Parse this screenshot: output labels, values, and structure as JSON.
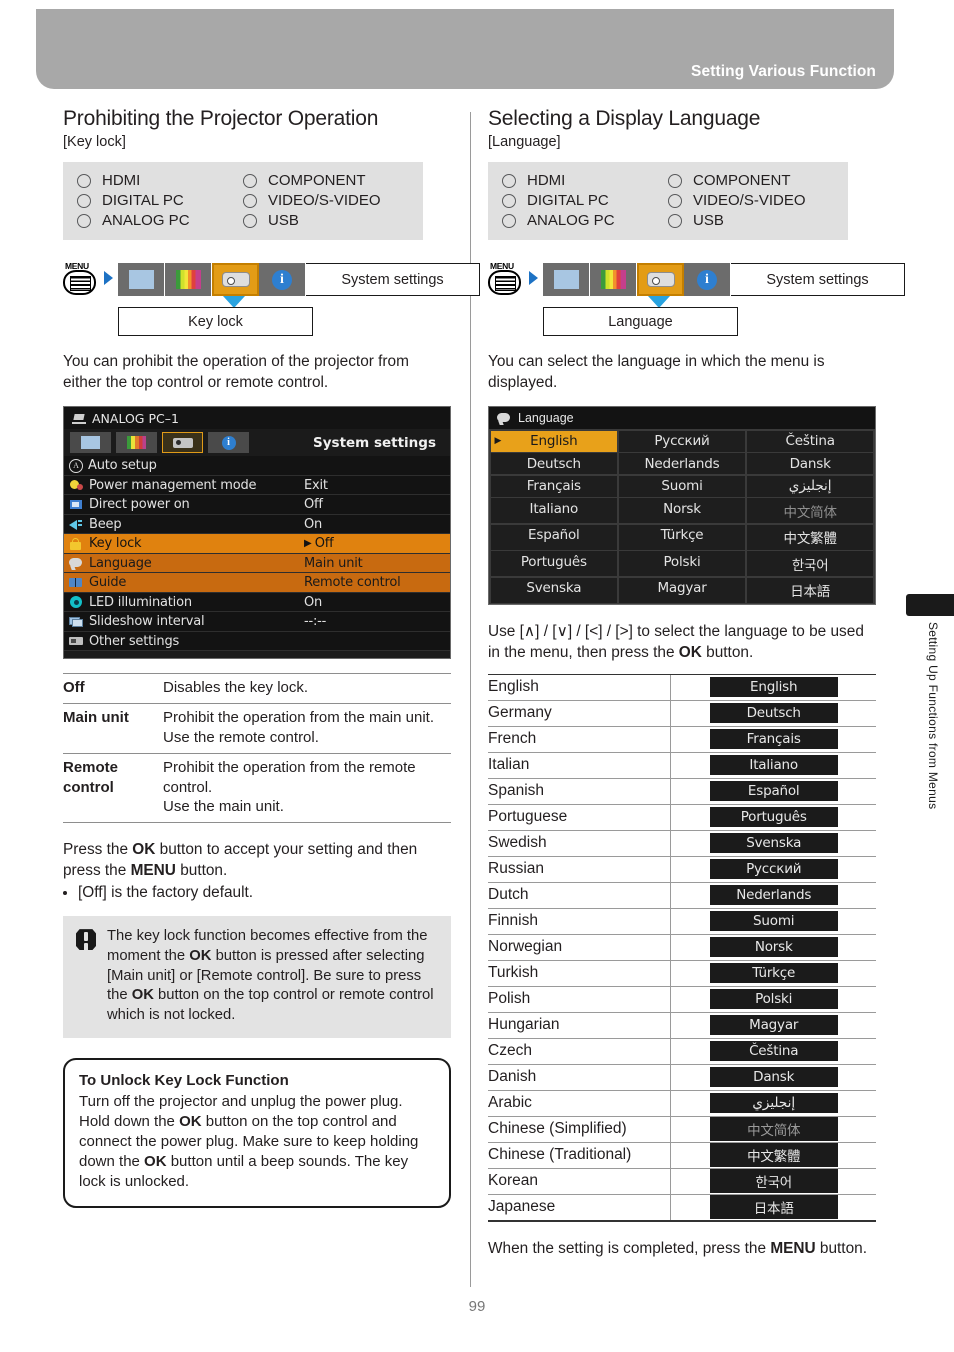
{
  "header": {
    "title": "Setting Various Function"
  },
  "page_number": "99",
  "side_tab": {
    "label": "Setting Up Functions from Menus"
  },
  "left": {
    "heading": "Prohibiting the Projector Operation",
    "bracket": "[Key lock]",
    "sources": [
      "HDMI",
      "COMPONENT",
      "DIGITAL PC",
      "VIDEO/S-VIDEO",
      "ANALOG PC",
      "USB"
    ],
    "nav": {
      "menu_label": "MENU",
      "system_settings": "System settings",
      "selected_label": "Key lock"
    },
    "intro": "You can prohibit the operation of the projector from either the top control or remote control.",
    "osd": {
      "title": "ANALOG PC–1",
      "system_settings": "System settings",
      "rows": [
        {
          "icon": "auto-setup-icon",
          "label": "Auto setup",
          "value": "",
          "state": "normal"
        },
        {
          "icon": "power-management-icon",
          "label": "Power management mode",
          "value": "Exit",
          "state": "normal"
        },
        {
          "icon": "direct-power-on-icon",
          "label": "Direct power on",
          "value": "Off",
          "state": "normal"
        },
        {
          "icon": "beep-icon",
          "label": "Beep",
          "value": "On",
          "state": "normal"
        },
        {
          "icon": "key-lock-icon",
          "label": "Key lock",
          "value": "Off",
          "state": "highlight"
        },
        {
          "icon": "language-icon",
          "label": "Language",
          "value": "Main unit",
          "state": "sub"
        },
        {
          "icon": "guide-icon",
          "label": "Guide",
          "value": "Remote control",
          "state": "sub"
        },
        {
          "icon": "led-illumination-icon",
          "label": "LED illumination",
          "value": "On",
          "state": "normal"
        },
        {
          "icon": "slideshow-interval-icon",
          "label": "Slideshow interval",
          "value": "--:--",
          "state": "normal"
        },
        {
          "icon": "other-settings-icon",
          "label": "Other settings",
          "value": "",
          "state": "normal"
        }
      ]
    },
    "table": [
      {
        "key": "Off",
        "desc": "Disables the key lock."
      },
      {
        "key": "Main unit",
        "desc": "Prohibit the operation from the main unit.\nUse the remote control."
      },
      {
        "key": "Remote control",
        "desc": "Prohibit the operation from the remote control.\nUse the main unit."
      }
    ],
    "press_ok": "Press the OK button to accept your setting and then press the MENU button.",
    "bullet": "[Off] is the factory default.",
    "note": "The key lock function becomes effective from the moment the OK button is pressed after selecting [Main unit] or [Remote control]. Be sure to press the OK button on the top control or remote control which is not locked.",
    "unlock_box": {
      "title": "To Unlock Key Lock Function",
      "body": "Turn off the projector and unplug the power plug. Hold down the OK button on the top control and connect the power plug. Make sure to keep holding down the OK button until a beep sounds. The key lock is unlocked."
    }
  },
  "right": {
    "heading": "Selecting a Display Language",
    "bracket": "[Language]",
    "sources": [
      "HDMI",
      "COMPONENT",
      "DIGITAL PC",
      "VIDEO/S-VIDEO",
      "ANALOG PC",
      "USB"
    ],
    "nav": {
      "menu_label": "MENU",
      "system_settings": "System settings",
      "selected_label": "Language"
    },
    "intro": "You can select the language in which the menu is displayed.",
    "osd": {
      "title": "Language",
      "grid": [
        {
          "label": "English",
          "state": "selected"
        },
        {
          "label": "Русский",
          "state": "normal"
        },
        {
          "label": "Čeština",
          "state": "normal"
        },
        {
          "label": "Deutsch",
          "state": "normal"
        },
        {
          "label": "Nederlands",
          "state": "normal"
        },
        {
          "label": "Dansk",
          "state": "normal"
        },
        {
          "label": "Français",
          "state": "normal"
        },
        {
          "label": "Suomi",
          "state": "normal"
        },
        {
          "label": "إنجليزي",
          "state": "normal"
        },
        {
          "label": "Italiano",
          "state": "normal"
        },
        {
          "label": "Norsk",
          "state": "normal"
        },
        {
          "label": "中文简体",
          "state": "dim"
        },
        {
          "label": "Español",
          "state": "normal"
        },
        {
          "label": "Türkçe",
          "state": "normal"
        },
        {
          "label": "中文繁體",
          "state": "normal"
        },
        {
          "label": "Português",
          "state": "normal"
        },
        {
          "label": "Polski",
          "state": "normal"
        },
        {
          "label": "한국어",
          "state": "normal"
        },
        {
          "label": "Svenska",
          "state": "normal"
        },
        {
          "label": "Magyar",
          "state": "normal"
        },
        {
          "label": "日本語",
          "state": "normal"
        }
      ]
    },
    "use_text": "Use [∧] / [∨] / [<] / [>] to select the language to be used in the menu, then press the OK button.",
    "lang_table": [
      {
        "english": "English",
        "native": "English",
        "dim": false
      },
      {
        "english": "Germany",
        "native": "Deutsch",
        "dim": false
      },
      {
        "english": "French",
        "native": "Français",
        "dim": false
      },
      {
        "english": "Italian",
        "native": "Italiano",
        "dim": false
      },
      {
        "english": "Spanish",
        "native": "Español",
        "dim": false
      },
      {
        "english": "Portuguese",
        "native": "Português",
        "dim": false
      },
      {
        "english": "Swedish",
        "native": "Svenska",
        "dim": false
      },
      {
        "english": "Russian",
        "native": "Русский",
        "dim": false
      },
      {
        "english": "Dutch",
        "native": "Nederlands",
        "dim": false
      },
      {
        "english": "Finnish",
        "native": "Suomi",
        "dim": false
      },
      {
        "english": "Norwegian",
        "native": "Norsk",
        "dim": false
      },
      {
        "english": "Turkish",
        "native": "Türkçe",
        "dim": false
      },
      {
        "english": "Polish",
        "native": "Polski",
        "dim": false
      },
      {
        "english": "Hungarian",
        "native": "Magyar",
        "dim": false
      },
      {
        "english": "Czech",
        "native": "Čeština",
        "dim": false
      },
      {
        "english": "Danish",
        "native": "Dansk",
        "dim": false
      },
      {
        "english": "Arabic",
        "native": "إنجليزي",
        "dim": false
      },
      {
        "english": "Chinese (Simplified)",
        "native": "中文简体",
        "dim": true
      },
      {
        "english": "Chinese (Traditional)",
        "native": "中文繁體",
        "dim": false
      },
      {
        "english": "Korean",
        "native": "한국어",
        "dim": false
      },
      {
        "english": "Japanese",
        "native": "日本語",
        "dim": false
      }
    ],
    "closing": "When the setting is completed, press the MENU button."
  }
}
